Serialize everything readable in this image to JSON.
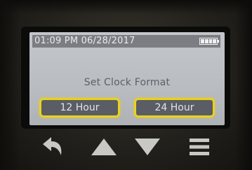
{
  "status_bar": {
    "datetime": "01:09 PM 06/28/2017",
    "battery_icon": "battery-full-icon"
  },
  "screen": {
    "title": "Set Clock Format",
    "options": [
      {
        "label": "12 Hour"
      },
      {
        "label": "24 Hour"
      }
    ],
    "highlight_color": "#e9d21e"
  },
  "hardware_buttons": [
    {
      "icon": "back-arrow-icon"
    },
    {
      "icon": "up-arrow-icon"
    },
    {
      "icon": "down-arrow-icon"
    },
    {
      "icon": "menu-icon"
    }
  ]
}
